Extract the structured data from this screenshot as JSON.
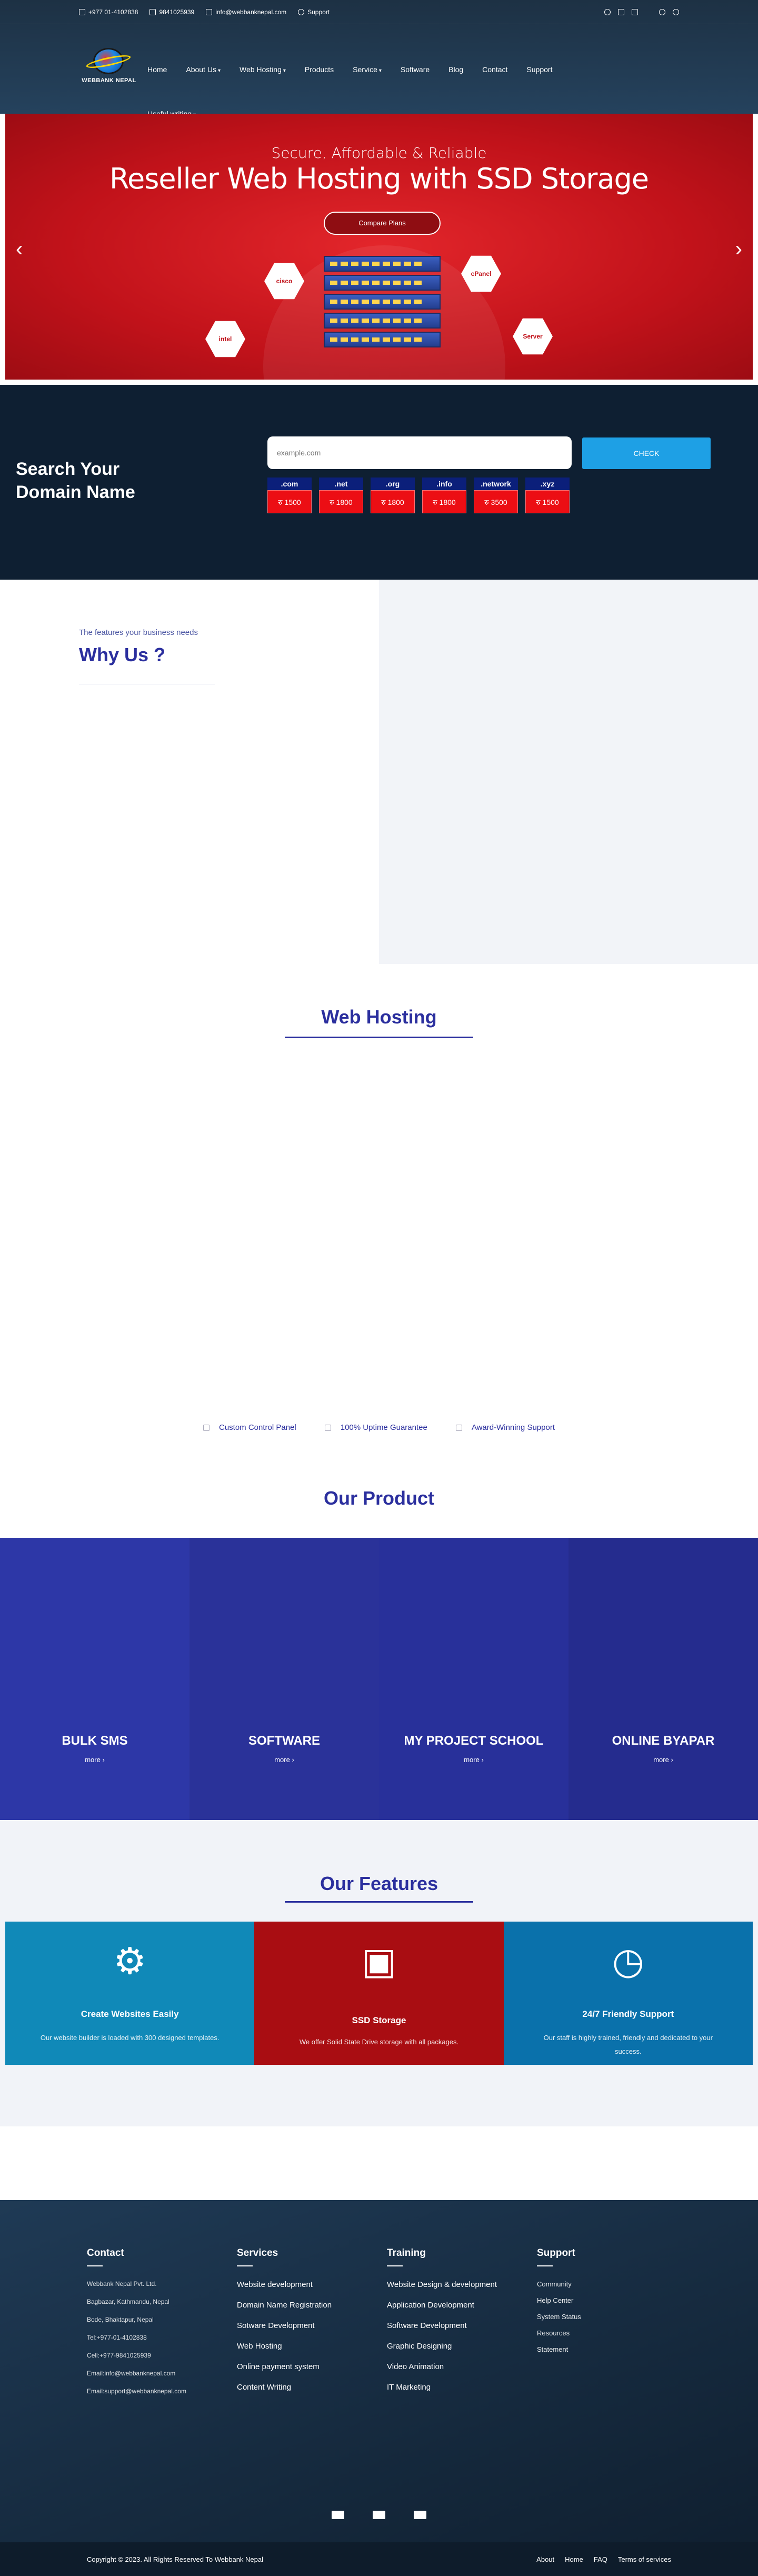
{
  "topbar": {
    "phone": "+977 01-4102838",
    "mobile": "9841025939",
    "email": "info@webbanknepal.com",
    "support": "Support"
  },
  "brand": {
    "logo_text": "WEBBANK NEPAL"
  },
  "nav": {
    "items": [
      "Home",
      "About Us",
      "Web Hosting",
      "Products",
      "Service",
      "Software",
      "Blog",
      "Contact",
      "Support"
    ],
    "second_row": "Useful writing"
  },
  "hero": {
    "subtitle": "Secure, Affordable & Reliable",
    "title": "Reseller Web Hosting with SSD Storage",
    "cta": "Compare Plans",
    "badges": [
      "cisco",
      "cPanel",
      "intel",
      "Server"
    ],
    "prev": "‹",
    "next": "›"
  },
  "domain": {
    "heading_line1": "Search Your",
    "heading_line2": "Domain Name",
    "placeholder": "example.com",
    "button": "CHECK",
    "tlds": [
      {
        "name": ".com",
        "price": "रु 1500"
      },
      {
        "name": ".net",
        "price": "रु 1800"
      },
      {
        "name": ".org",
        "price": "रु 1800"
      },
      {
        "name": ".info",
        "price": "रु 1800"
      },
      {
        "name": ".network",
        "price": "रु 3500"
      },
      {
        "name": ".xyz",
        "price": "रु 1500"
      }
    ]
  },
  "why": {
    "kicker": "The features your business needs",
    "title": "Why Us ?"
  },
  "hosting": {
    "title": "Web Hosting",
    "features": [
      "Custom Control Panel",
      "100% Uptime Guarantee",
      "Award-Winning Support"
    ]
  },
  "products": {
    "title": "Our Product",
    "items": [
      {
        "name": "BULK SMS",
        "more": "more",
        "color": "#2d37a7"
      },
      {
        "name": "SOFTWARE",
        "more": "more",
        "color": "#2a3299"
      },
      {
        "name": "MY PROJECT SCHOOL",
        "more": "more",
        "color": "#28309a"
      },
      {
        "name": "ONLINE BYAPAR",
        "more": "more",
        "color": "#252c8e"
      }
    ]
  },
  "features": {
    "title": "Our Features",
    "items": [
      {
        "title": "Create Websites Easily",
        "text": "Our website builder is loaded with 300 designed templates.",
        "color": "#1089b8",
        "icon": "www-gear-icon"
      },
      {
        "title": "SSD Storage",
        "text": "We offer Solid State Drive storage with all packages.",
        "color": "#a90d12",
        "icon": "ssd-icon"
      },
      {
        "title": "24/7 Friendly Support",
        "text": "Our staff is highly trained, friendly and dedicated to your success.",
        "color": "#0a71ab",
        "icon": "clock-support-icon"
      }
    ]
  },
  "footer": {
    "contact": {
      "title": "Contact",
      "lines": [
        "Webbank Nepal Pvt. Ltd.",
        "Bagbazar, Kathmandu, Nepal",
        "Bode, Bhaktapur, Nepal",
        "Tel:+977-01-4102838",
        "Cell:+977-9841025939",
        "Email:info@webbanknepal.com",
        "Email:support@webbanknepal.com"
      ]
    },
    "services": {
      "title": "Services",
      "lines": [
        "Website development",
        "Domain Name Registration",
        "Sotware Development",
        "Web Hosting",
        "Online payment system",
        "Content Writing"
      ]
    },
    "training": {
      "title": "Training",
      "lines": [
        "Website Design & development",
        "Application Development",
        "Software Development",
        "Graphic Designing",
        "Video Animation",
        "IT Marketing"
      ]
    },
    "support": {
      "title": "Support",
      "lines": [
        "Community",
        "Help Center",
        "System Status",
        "Resources",
        "Statement"
      ]
    },
    "copyright": "Copyright © 2023. All Rights Reserved To Webbank Nepal",
    "links": [
      "About",
      "Home",
      "FAQ",
      "Terms of services"
    ]
  }
}
